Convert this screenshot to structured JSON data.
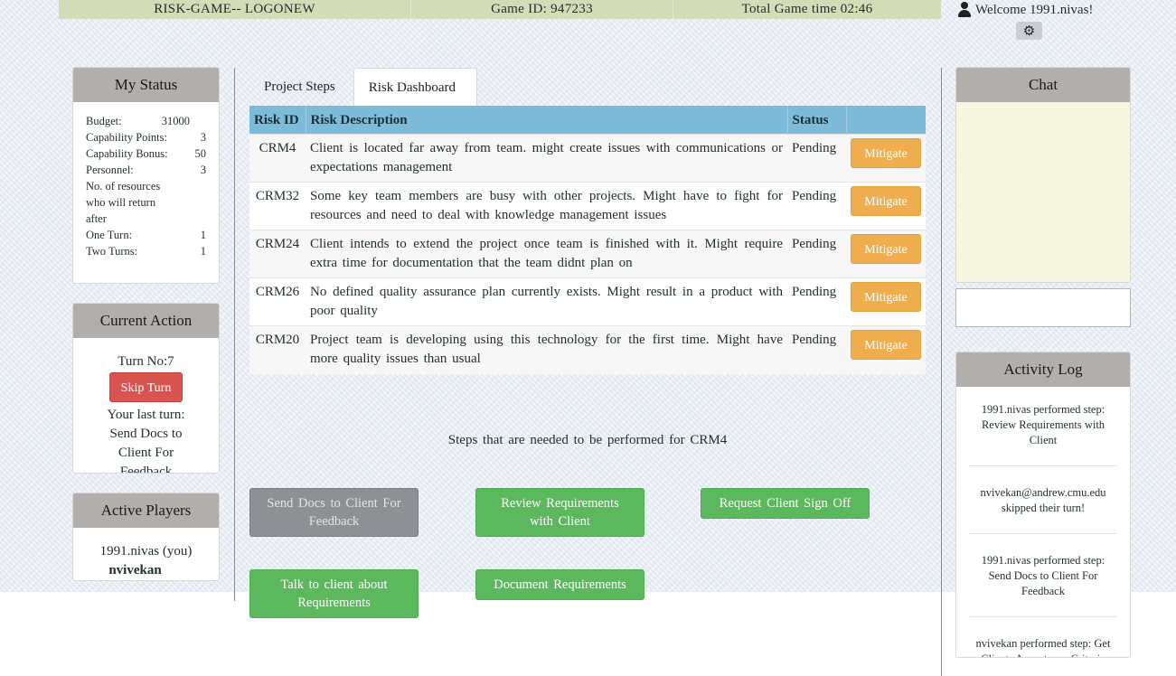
{
  "header": {
    "logo": "RISK-GAME-- LOGONEW",
    "game_id": "Game ID: 947233",
    "game_time": "Total Game time 02:46",
    "welcome": "Welcome  1991.nivas!"
  },
  "my_status": {
    "title": "My Status",
    "rows": [
      {
        "label": "Budget:",
        "value": "31000"
      },
      {
        "label": "Capability Points:",
        "value": "3"
      },
      {
        "label": "Capability Bonus:",
        "value": "50"
      },
      {
        "label": "Personnel:",
        "value": "3"
      }
    ],
    "note_lines": [
      "No. of resources",
      "who will return",
      "after"
    ],
    "return_rows": [
      {
        "label": "One Turn:",
        "value": "1"
      },
      {
        "label": "Two Turns:",
        "value": "1"
      }
    ]
  },
  "current_action": {
    "title": "Current Action",
    "turn": "Turn No:7",
    "skip_label": "Skip Turn",
    "last_turn_label": "Your last turn:",
    "last_turn_value": "Send Docs to Client For Feedback"
  },
  "active_players": {
    "title": "Active Players",
    "players": [
      "1991.nivas (you)",
      "nvivekan"
    ]
  },
  "tabs": [
    {
      "label": "Project Steps",
      "active": false
    },
    {
      "label": "Risk Dashboard",
      "active": true
    }
  ],
  "risk_table": {
    "headers": {
      "id": "Risk ID",
      "desc": "Risk Description",
      "status": "Status",
      "action": ""
    },
    "rows": [
      {
        "id": "CRM4",
        "desc": "Client is located far away from team. might create issues with communications or expectations management",
        "status": "Pending",
        "action": "Mitigate"
      },
      {
        "id": "CRM32",
        "desc": "Some key team members are busy with other projects. Might have to fight for resources and need to deal with knowledge management issues",
        "status": "Pending",
        "action": "Mitigate"
      },
      {
        "id": "CRM24",
        "desc": "Client intends to extend the project once team is finished with it. Might require extra time for documentation that the team didnt plan on",
        "status": "Pending",
        "action": "Mitigate"
      },
      {
        "id": "CRM26",
        "desc": "No defined quality assurance plan currently exists. Might result in a product with poor quality",
        "status": "Pending",
        "action": "Mitigate"
      },
      {
        "id": "CRM20",
        "desc": "Project team is developing using this technology for the first time. Might have more quality issues than usual",
        "status": "Pending",
        "action": "Mitigate"
      }
    ]
  },
  "steps": {
    "title": "Steps that are needed to be performed for CRM4",
    "buttons": [
      {
        "label": "Send Docs to Client For Feedback",
        "disabled": true
      },
      {
        "label": "Review Requirements with Client",
        "disabled": false
      },
      {
        "label": "Request Client Sign Off",
        "disabled": false
      },
      {
        "label": "Talk to client about Requirements",
        "disabled": false
      },
      {
        "label": "Document Requirements",
        "disabled": false
      }
    ]
  },
  "chat": {
    "title": "Chat",
    "input_value": ""
  },
  "activity_log": {
    "title": "Activity Log",
    "items": [
      "1991.nivas performed step: Review Requirements with Client",
      "nvivekan@andrew.cmu.edu skipped their turn!",
      "1991.nivas performed step: Send Docs to Client For Feedback",
      "nvivekan performed step: Get Clients Acceptance Criteria"
    ]
  },
  "colors": {
    "header_bar": "#d2dcb7",
    "table_header": "#7dbcd8",
    "mitigate": "#f0ad4e",
    "step_button": "#5cb85c",
    "skip_button": "#d9534f",
    "panel_header": "#b2aeab",
    "chat_bg": "#f7f6df"
  },
  "icons": {
    "user": "user-icon",
    "settings": "gear-icon"
  }
}
